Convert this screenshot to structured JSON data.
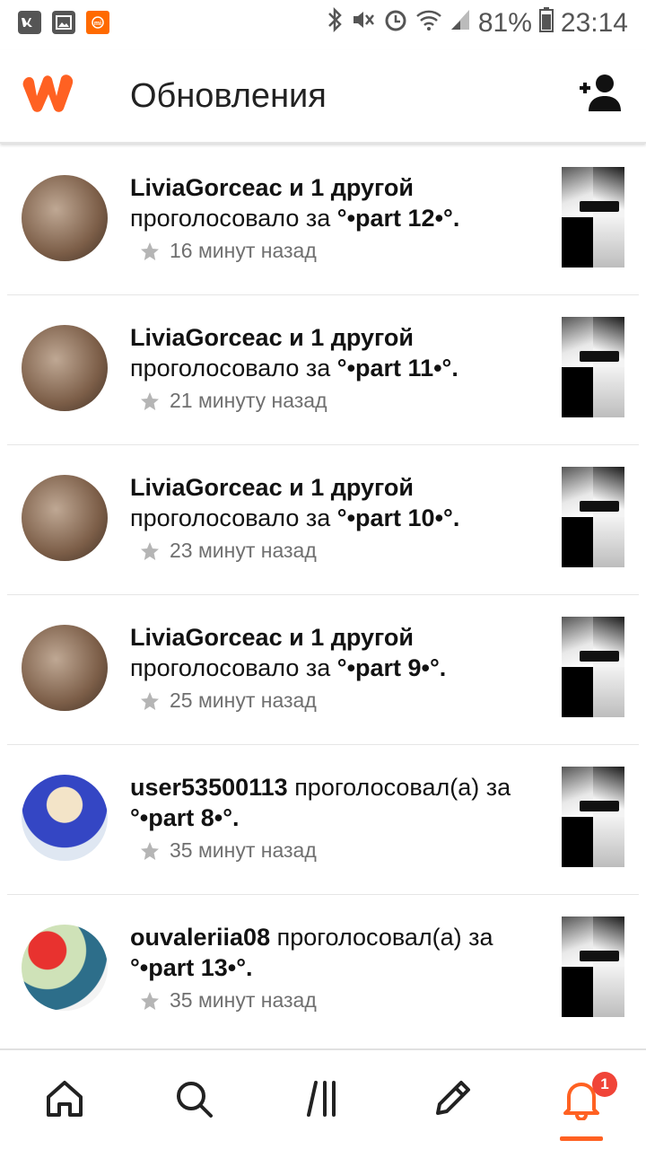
{
  "status_bar": {
    "battery": "81%",
    "time": "23:14",
    "left_icons": [
      "vk-icon",
      "gallery-icon",
      "mi-icon"
    ],
    "right_icons": [
      "bluetooth-icon",
      "mute-icon",
      "alarm-icon",
      "wifi-icon",
      "signal-icon",
      "battery-icon"
    ]
  },
  "header": {
    "title": "Обновления",
    "logo_icon": "wattpad-logo-icon",
    "add_user_icon": "add-user-icon",
    "brand_color": "#FF6122"
  },
  "notifications": [
    {
      "user": "LiviaGorceac и 1 другой",
      "action": "проголосовало за",
      "story": "°•part 12•°.",
      "time": "16 минут назад",
      "avatar": "avatar-a"
    },
    {
      "user": "LiviaGorceac и 1 другой",
      "action": "проголосовало за",
      "story": "°•part 11•°.",
      "time": "21 минуту назад",
      "avatar": "avatar-a"
    },
    {
      "user": "LiviaGorceac и 1 другой",
      "action": "проголосовало за",
      "story": "°•part 10•°.",
      "time": "23 минут назад",
      "avatar": "avatar-a"
    },
    {
      "user": "LiviaGorceac и 1 другой",
      "action": "проголосовало за",
      "story": "°•part 9•°.",
      "time": "25 минут назад",
      "avatar": "avatar-a"
    },
    {
      "user": "user53500113",
      "action": "проголосовал(а) за",
      "story": "°•part 8•°.",
      "time": "35 минут назад",
      "avatar": "avatar-b"
    },
    {
      "user": "ouvaleriia08",
      "action": "проголосовал(а) за",
      "story": "°•part 13•°.",
      "time": "35 минут назад",
      "avatar": "avatar-c"
    }
  ],
  "bottom_nav": {
    "items": [
      "home-icon",
      "search-icon",
      "library-icon",
      "write-icon",
      "notifications-icon"
    ],
    "active": "notifications-icon",
    "notification_badge": "1"
  }
}
